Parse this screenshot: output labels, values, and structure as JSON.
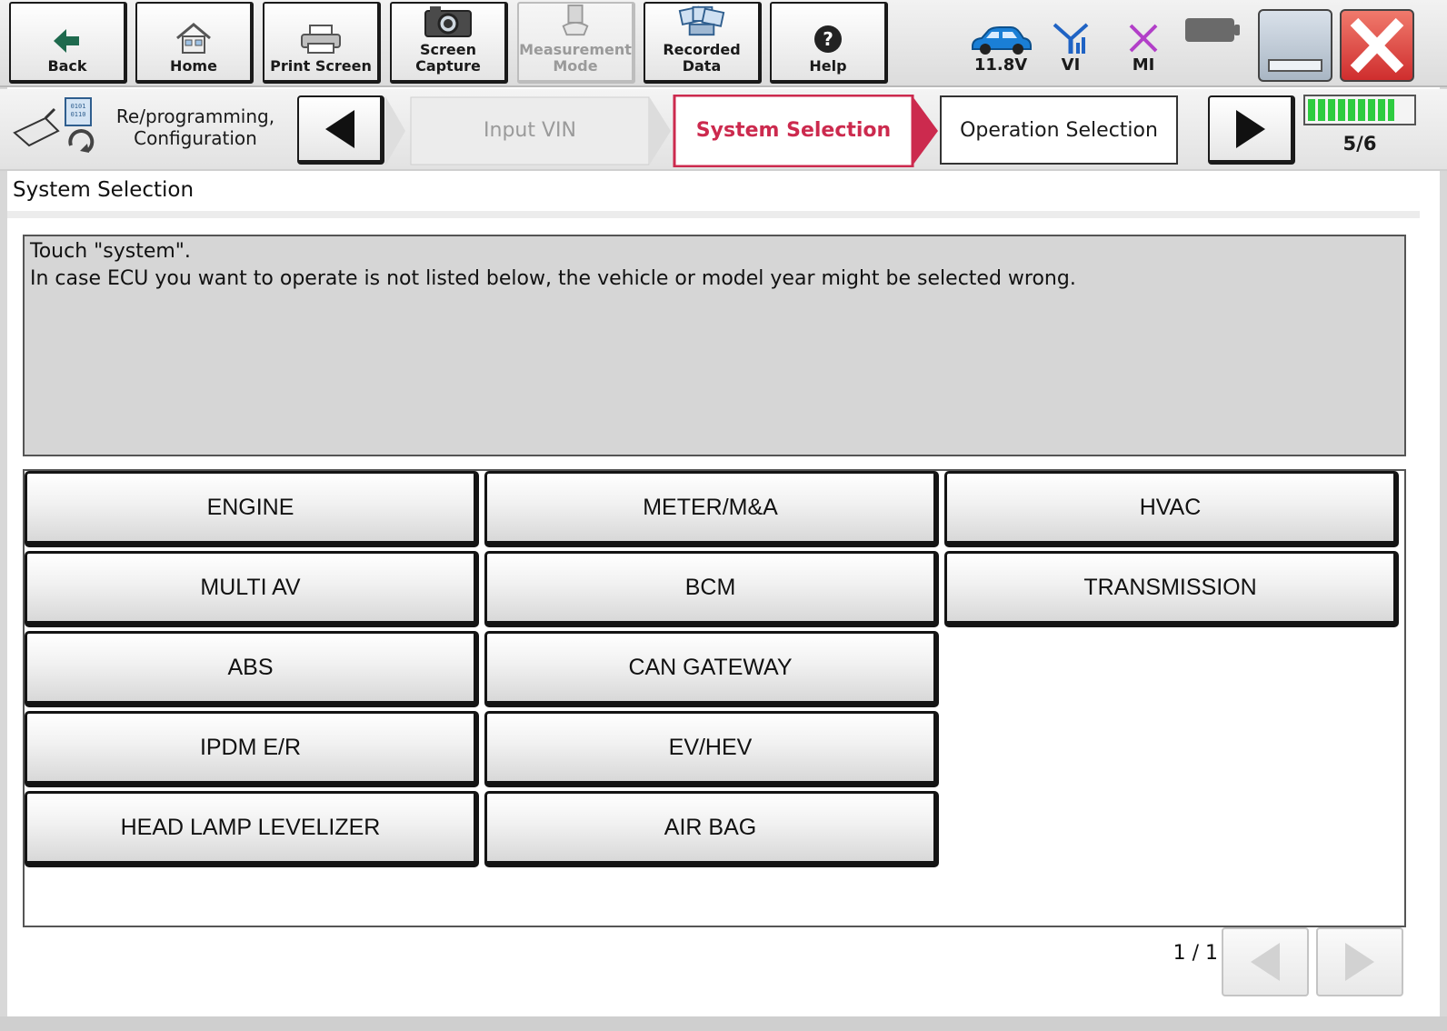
{
  "toolbar": {
    "buttons": [
      {
        "label": "Back",
        "icon": "back-arrow-icon",
        "enabled": true
      },
      {
        "label": "Home",
        "icon": "home-icon",
        "enabled": true
      },
      {
        "label": "Print Screen",
        "icon": "printer-icon",
        "enabled": true
      },
      {
        "label": "Screen\nCapture",
        "icon": "camera-icon",
        "enabled": true
      },
      {
        "label": "Measurement\nMode",
        "icon": "measurement-icon",
        "enabled": false
      },
      {
        "label": "Recorded\nData",
        "icon": "recorded-data-icon",
        "enabled": true
      },
      {
        "label": "Help",
        "icon": "help-icon",
        "enabled": true
      }
    ],
    "status": {
      "voltage": "11.8V",
      "vi_label": "VI",
      "mi_label": "MI"
    },
    "colors": {
      "car": "#1a7fd6",
      "vi": "#1f63c4",
      "mi": "#b23fc8",
      "close": "#d83a3a"
    }
  },
  "stepbar": {
    "module_line1": "Re/programming,",
    "module_line2": "Configuration",
    "steps": {
      "previous": "Input VIN",
      "current": "System Selection",
      "next": "Operation Selection"
    },
    "progress_text": "5/6",
    "progress_fraction": 0.833,
    "accent_color": "#cc2a4e"
  },
  "page": {
    "title": "System Selection",
    "instruction_line1": "Touch  \"system\".",
    "instruction_line2": "In case ECU you want to operate is not listed below, the vehicle or model year might be selected wrong."
  },
  "systems": [
    "ENGINE",
    "METER/M&A",
    "HVAC",
    "MULTI AV",
    "BCM",
    "TRANSMISSION",
    "ABS",
    "CAN GATEWAY",
    "IPDM E/R",
    "EV/HEV",
    "HEAD LAMP LEVELIZER",
    "AIR BAG"
  ],
  "pager": {
    "text": "1 / 1"
  }
}
